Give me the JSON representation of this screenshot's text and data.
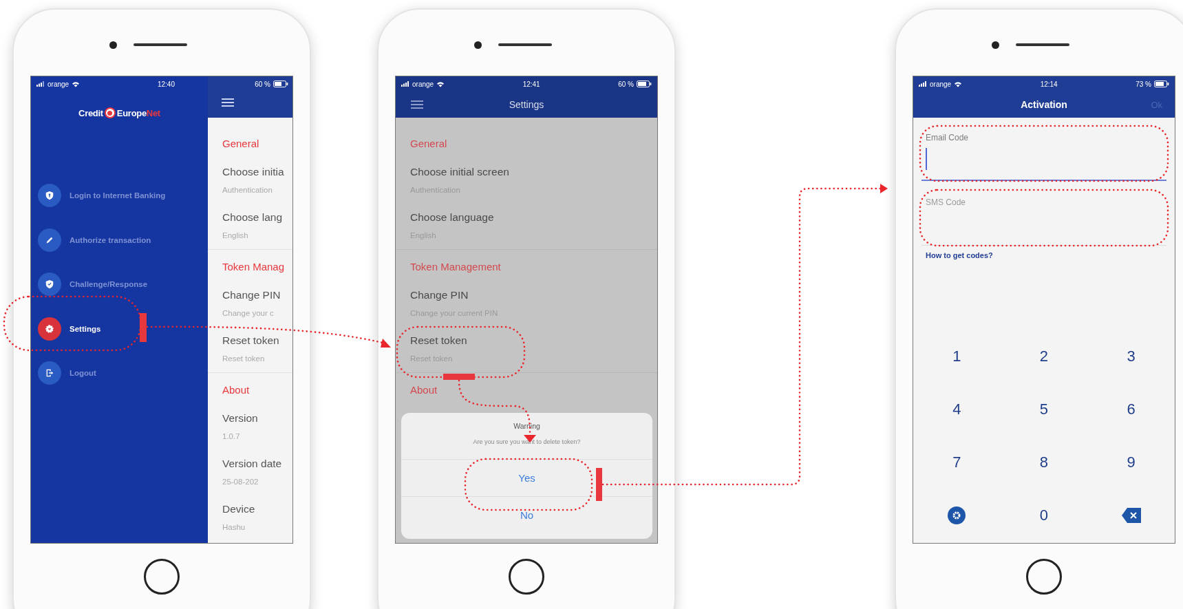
{
  "phones": [
    {
      "kind": "drawer",
      "status": {
        "carrier": "orange",
        "time": "12:40",
        "battery": "60 %"
      },
      "logo": {
        "part_1": "Credit",
        "part_2": "Europe",
        "part_3": "Net"
      },
      "menu": [
        {
          "label": "Login to Internet Banking",
          "selected": false
        },
        {
          "label": "Authorize transaction",
          "selected": false
        },
        {
          "label": "Challenge/Response",
          "selected": false
        },
        {
          "label": "Settings",
          "selected": true
        },
        {
          "label": "Logout",
          "selected": false
        }
      ],
      "sections": [
        {
          "title": "General",
          "items": [
            {
              "title": "Choose initia",
              "value": "Authentication"
            },
            {
              "title": "Choose lang",
              "value": "English"
            }
          ]
        },
        {
          "title": "Token Manag",
          "items": [
            {
              "title": "Change PIN",
              "value": "Change your c"
            },
            {
              "title": "Reset token",
              "value": "Reset token"
            }
          ]
        },
        {
          "title": "About",
          "items": [
            {
              "title": "Version",
              "value": "1.0.7"
            },
            {
              "title": "Version date",
              "value": "25-08-202"
            },
            {
              "title": "Device",
              "value": "Hashu"
            }
          ]
        }
      ]
    },
    {
      "kind": "settings",
      "status": {
        "carrier": "orange",
        "time": "12:41",
        "battery": "60 %"
      },
      "title": "Settings",
      "sections": [
        {
          "title": "General",
          "items": [
            {
              "title": "Choose initial screen",
              "value": "Authentication"
            },
            {
              "title": "Choose language",
              "value": "English"
            }
          ]
        },
        {
          "title": "Token Management",
          "items": [
            {
              "title": "Change PIN",
              "value": "Change your current PIN"
            },
            {
              "title": "Reset token",
              "value": "Reset token"
            }
          ]
        },
        {
          "title": "About"
        }
      ],
      "dialog": {
        "title": "Warning",
        "message": "Are you sure you want to delete token?",
        "buttons": [
          "Yes",
          "No"
        ]
      }
    },
    {
      "kind": "activation",
      "status": {
        "carrier": "orange",
        "time": "12:14",
        "battery": "73 %"
      },
      "title": "Activation",
      "action": {
        "label": "Ok",
        "disabled": true
      },
      "fields": [
        {
          "label": "Email Code",
          "focused": true
        },
        {
          "label": "SMS Code",
          "focused": false
        }
      ],
      "link": "How to get codes?",
      "keys": [
        {
          "kind": "digit",
          "label": "1"
        },
        {
          "kind": "digit",
          "label": "2"
        },
        {
          "kind": "digit",
          "label": "3"
        },
        {
          "kind": "digit",
          "label": "4"
        },
        {
          "kind": "digit",
          "label": "5"
        },
        {
          "kind": "digit",
          "label": "6"
        },
        {
          "kind": "digit",
          "label": "7"
        },
        {
          "kind": "digit",
          "label": "8"
        },
        {
          "kind": "digit",
          "label": "9"
        },
        {
          "kind": "settings"
        },
        {
          "kind": "digit",
          "label": "0"
        },
        {
          "kind": "backspace"
        }
      ]
    }
  ]
}
